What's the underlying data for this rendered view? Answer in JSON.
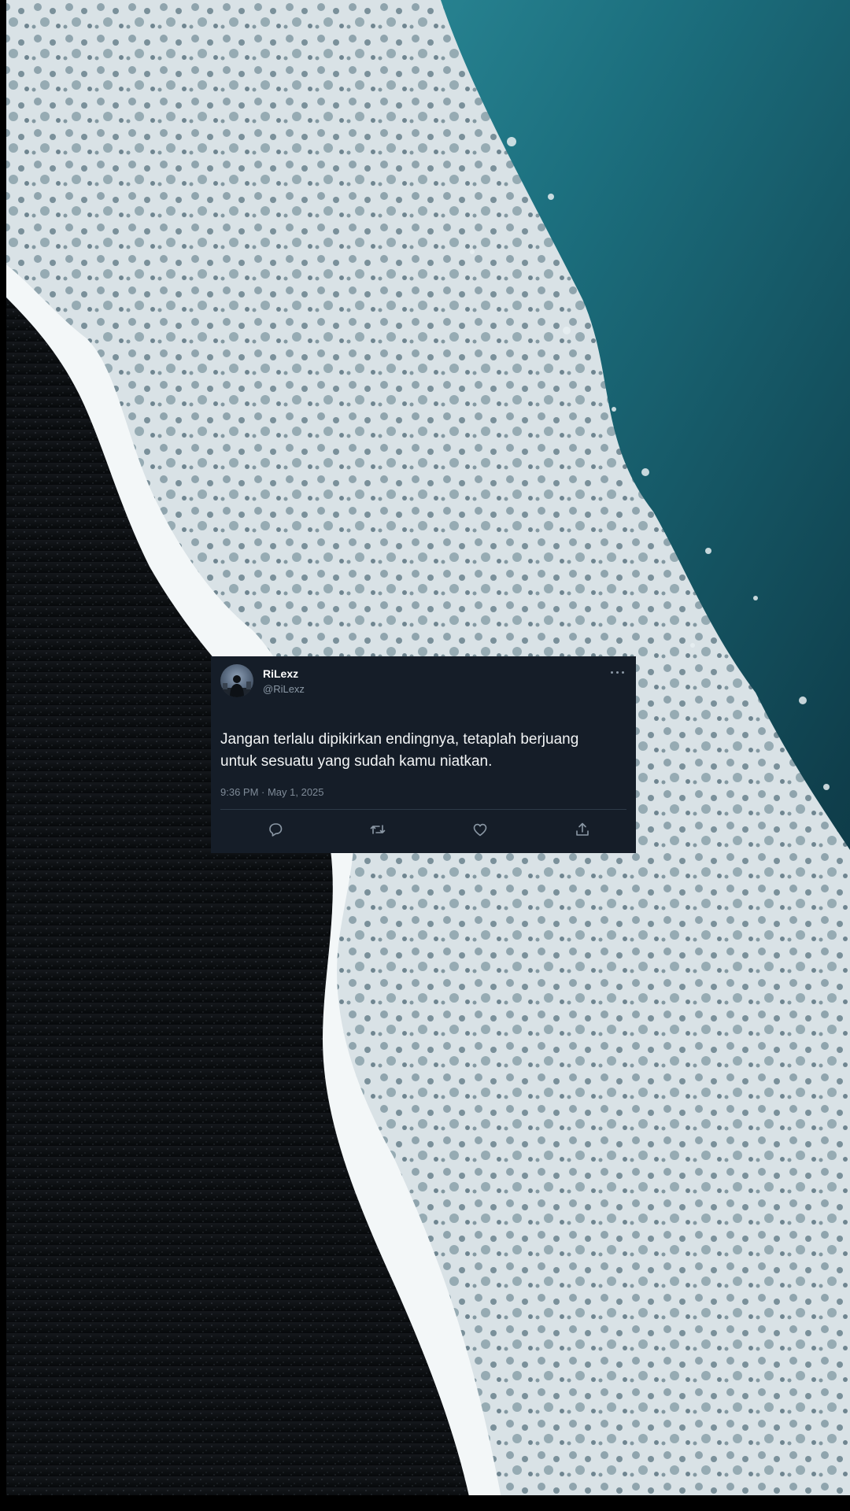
{
  "tweet": {
    "display_name": "RiLexz",
    "handle": "@RiLexz",
    "text_line_1": "Jangan terlalu dipikirkan endingnya, tetaplah berjuang",
    "text_line_2": "untuk sesuatu yang sudah kamu niatkan.",
    "timestamp": "9:36 PM · May 1, 2025"
  },
  "actions": [
    {
      "icon": "reply-icon"
    },
    {
      "icon": "retweet-icon"
    },
    {
      "icon": "like-icon"
    },
    {
      "icon": "share-icon"
    }
  ],
  "colors": {
    "card_background": "#151d28",
    "text_primary": "#f2f4f5",
    "text_secondary": "#8b98a5",
    "sea_teal": "#1f7f8f",
    "sand_black": "#0b0d10",
    "foam_white": "#eef3f5"
  }
}
